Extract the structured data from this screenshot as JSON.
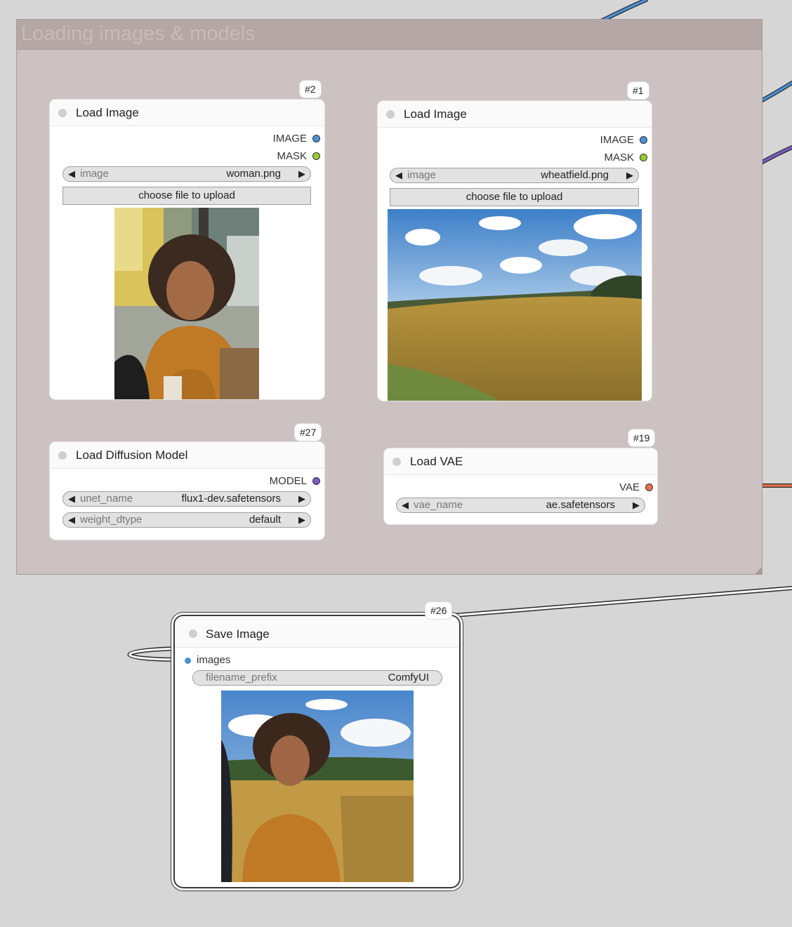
{
  "group": {
    "title": "Loading images & models"
  },
  "nodes": {
    "load_image_2": {
      "id": "#2",
      "title": "Load Image",
      "outputs": [
        "IMAGE",
        "MASK"
      ],
      "widget": {
        "name": "image",
        "value": "woman.png"
      },
      "upload_label": "choose file to upload",
      "preview": "woman-portrait"
    },
    "load_image_1": {
      "id": "#1",
      "title": "Load Image",
      "outputs": [
        "IMAGE",
        "MASK"
      ],
      "widget": {
        "name": "image",
        "value": "wheatfield.png"
      },
      "upload_label": "choose file to upload",
      "preview": "wheat-field-landscape"
    },
    "load_diffusion_27": {
      "id": "#27",
      "title": "Load Diffusion Model",
      "outputs": [
        "MODEL"
      ],
      "widgets": [
        {
          "name": "unet_name",
          "value": "flux1-dev.safetensors"
        },
        {
          "name": "weight_dtype",
          "value": "default"
        }
      ]
    },
    "load_vae_19": {
      "id": "#19",
      "title": "Load VAE",
      "outputs": [
        "VAE"
      ],
      "widget": {
        "name": "vae_name",
        "value": "ae.safetensors"
      }
    },
    "save_image_26": {
      "id": "#26",
      "title": "Save Image",
      "inputs": [
        "images"
      ],
      "widget": {
        "name": "filename_prefix",
        "value": "ComfyUI"
      },
      "preview": "woman-in-wheat-field"
    }
  },
  "colors": {
    "image_link": "#4a90d9",
    "mask_socket": "#9acd32",
    "model_link": "#7b5cc4",
    "vae_link": "#e8704f",
    "canvas": "#d6d6d6",
    "group_body": "#cbc2c1",
    "group_header": "#b5a7a6"
  },
  "icons": {
    "arrow_left": "◀",
    "arrow_right": "▶"
  }
}
